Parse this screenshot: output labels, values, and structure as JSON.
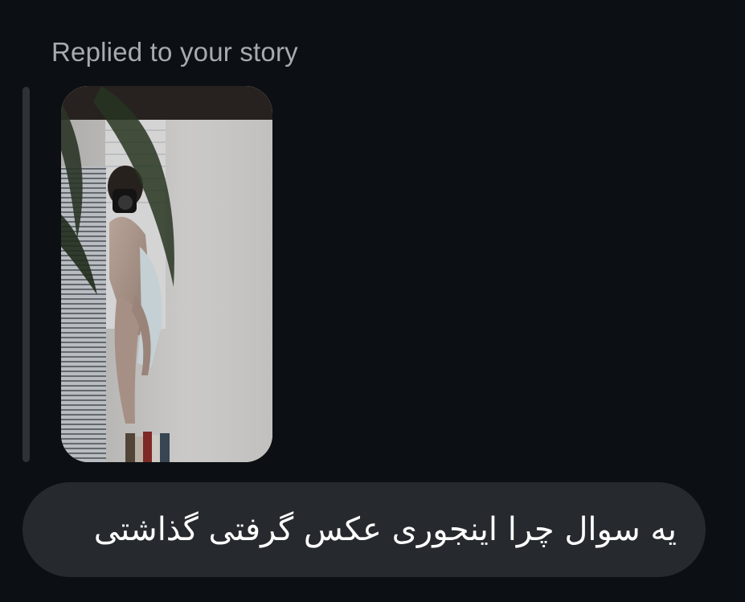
{
  "conversation": {
    "reply_context": {
      "label": "Replied to your story",
      "story_thumbnail": {
        "icon": "story-photo-thumbnail"
      }
    },
    "message": {
      "text": "یه سوال چرا اینجوری عکس گرفتی گذاشتی",
      "direction": "rtl"
    }
  },
  "colors": {
    "background": "#0c1014",
    "bubble": "#262a2e",
    "secondary_text": "#a7abb0",
    "reply_bar": "#2e3236",
    "message_text": "#ffffff"
  }
}
